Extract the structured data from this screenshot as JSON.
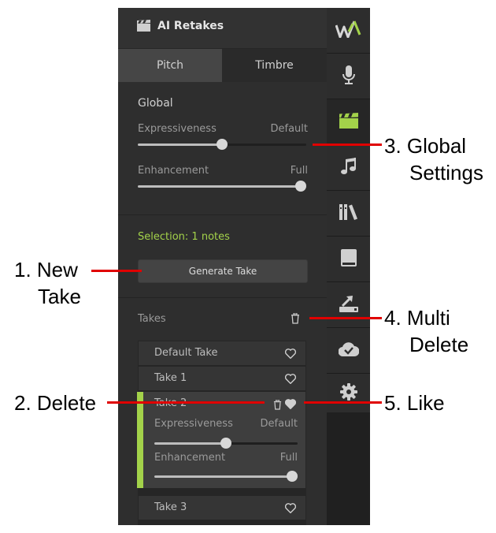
{
  "header": {
    "title": "AI Retakes"
  },
  "tabs": [
    {
      "label": "Pitch"
    },
    {
      "label": "Timbre"
    }
  ],
  "global": {
    "title": "Global",
    "expressiveness": {
      "label": "Expressiveness",
      "value_label": "Default",
      "value": 0.5
    },
    "enhancement": {
      "label": "Enhancement",
      "value_label": "Full",
      "value": 1.0
    }
  },
  "selection": {
    "text": "Selection: 1 notes",
    "button_label": "Generate Take"
  },
  "takes": {
    "title": "Takes",
    "items": [
      {
        "name": "Default Take"
      },
      {
        "name": "Take 1"
      },
      {
        "name": "Take 2",
        "expressiveness": {
          "label": "Expressiveness",
          "value_label": "Default",
          "value": 0.5
        },
        "enhancement": {
          "label": "Enhancement",
          "value_label": "Full",
          "value": 1.0
        }
      },
      {
        "name": "Take 3"
      }
    ]
  },
  "annotations": {
    "new_take": [
      "1. New",
      "Take"
    ],
    "delete": "2. Delete",
    "global_settings": [
      "3. Global",
      "Settings"
    ],
    "multi_delete": [
      "4. Multi",
      "Delete"
    ],
    "like": "5. Like"
  },
  "colors": {
    "accent": "#a3d24a",
    "annotation_line": "#e00000",
    "panel_bg": "#2e2e2e"
  },
  "sidebar": {
    "icons": [
      "logo-icon",
      "microphone-icon",
      "clapperboard-icon",
      "music-note-icon",
      "library-icon",
      "book-icon",
      "export-icon",
      "cloud-check-icon",
      "gear-icon"
    ]
  }
}
